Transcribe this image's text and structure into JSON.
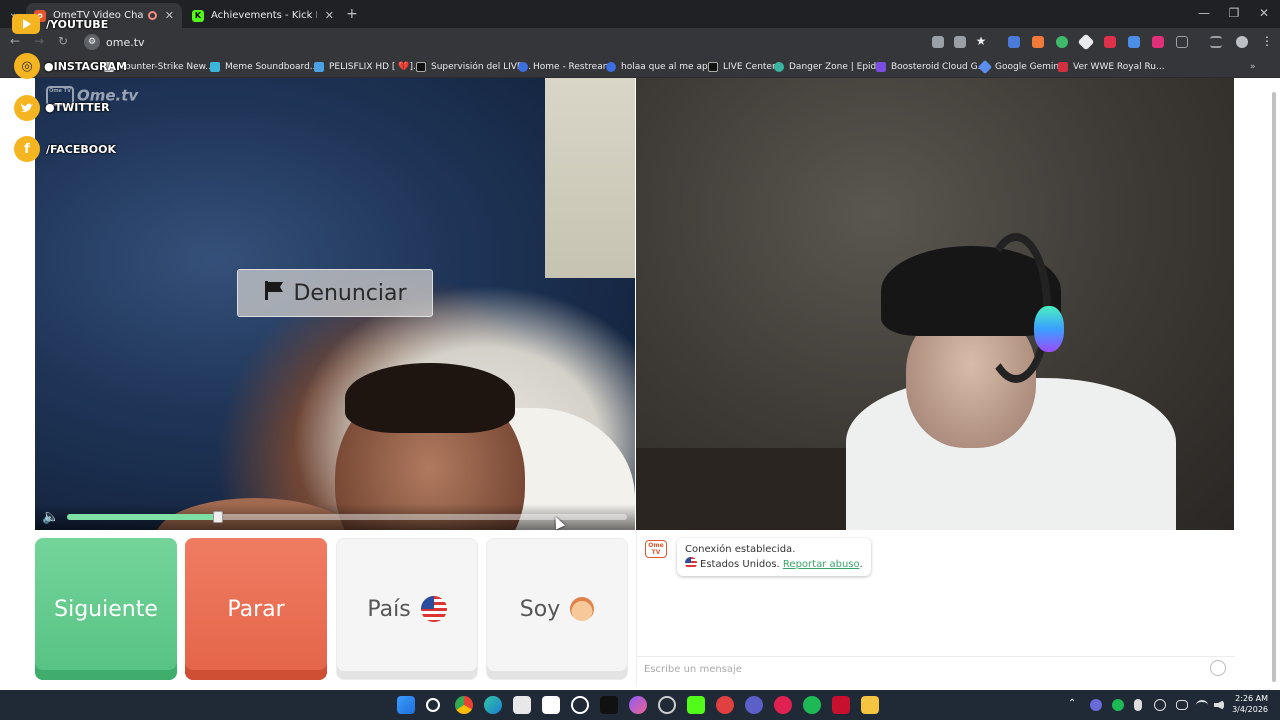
{
  "browser": {
    "tabs": [
      {
        "title": "OmeTV Video Chat — Omeg",
        "active": true
      },
      {
        "title": "Achievements - Kick Dashboard",
        "active": false
      }
    ],
    "url": "ome.tv",
    "bookmarks": [
      "Counter-Strike New...",
      "Meme Soundboard...",
      "PELISFLIX HD [ 💔]...",
      "Supervisión del LIVE...",
      "Home - Restream",
      "holaa que al me ap...",
      "LIVE Center",
      "Danger Zone | Epid...",
      "Boosteroid Cloud G...",
      "Google Gemini",
      "Ver WWE Royal Ru..."
    ]
  },
  "overlay": {
    "youtube": "/YOUTUBE",
    "instagram": "●INSTAGRAM",
    "twitter": "●TWITTER",
    "facebook": "/FACEBOOK",
    "logo": "Ome.tv",
    "logo_box": "Ome TV"
  },
  "video": {
    "report_label": "Denunciar",
    "volume_level": 0.27
  },
  "controls": {
    "next": "Siguiente",
    "stop": "Parar",
    "country": "País",
    "me": "Soy"
  },
  "chat": {
    "logo": "Ome TV",
    "connected": "Conexión establecida.",
    "country": "Estados Unidos.",
    "report_abuse": "Reportar abuso",
    "placeholder": "Escribe un mensaje"
  },
  "taskbar": {
    "time": "2:26 AM",
    "date": "3/4/2026"
  },
  "colors": {
    "accent_green": "#55c281",
    "accent_red": "#e46448",
    "social_yellow": "#f5b521"
  }
}
